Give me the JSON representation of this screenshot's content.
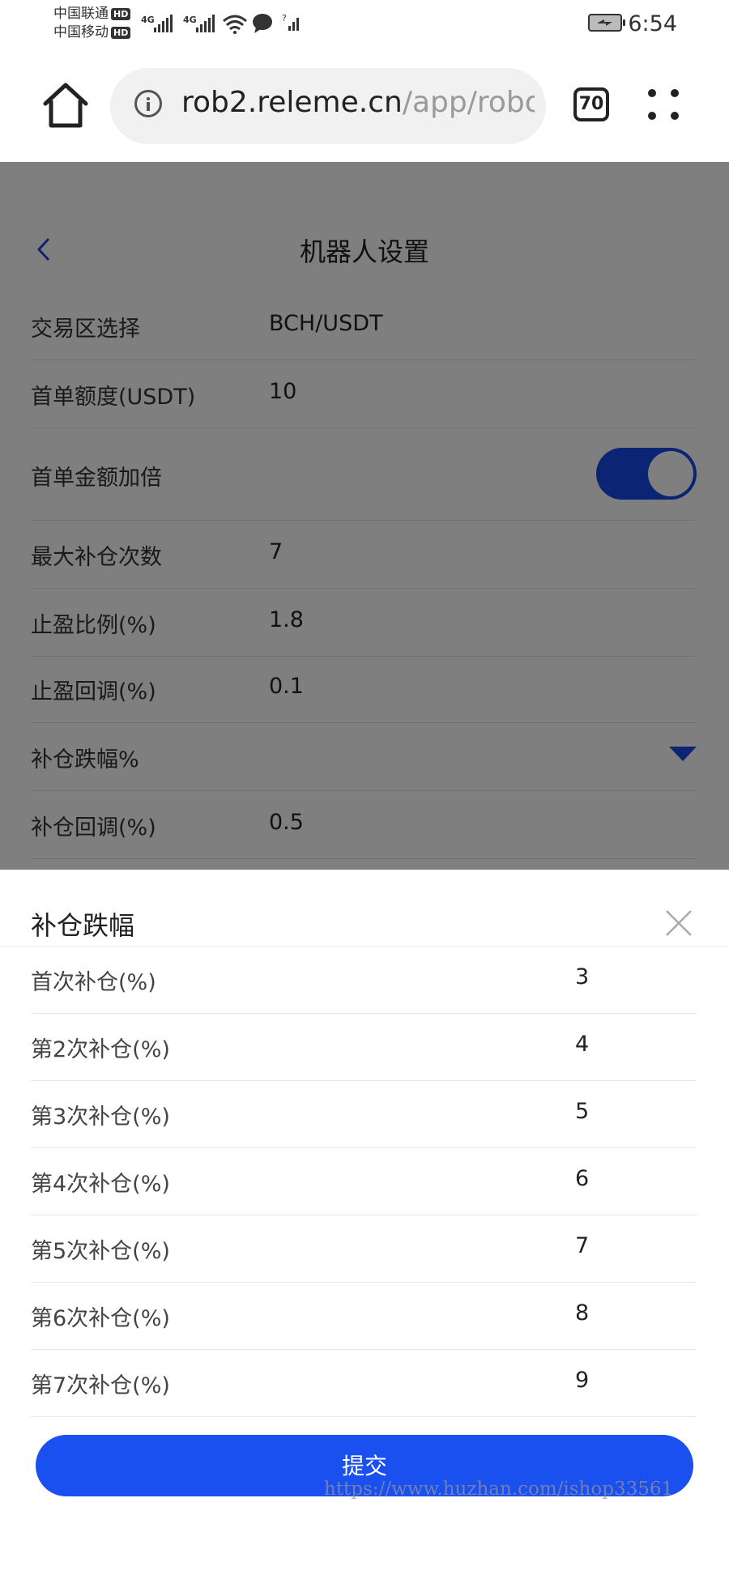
{
  "status_bar": {
    "carrier1": "中国联通",
    "carrier2": "中国移动",
    "hd": "HD",
    "net1": "4G",
    "net2": "4G",
    "time": "6:54"
  },
  "browser": {
    "url_host": "rob2.releme.cn",
    "url_path": "/app/robot",
    "tab_count": "70"
  },
  "page": {
    "title": "机器人设置",
    "rows": [
      {
        "label": "交易区选择",
        "value": "BCH/USDT"
      },
      {
        "label": "首单额度(USDT)",
        "value": "10"
      },
      {
        "label": "首单金额加倍",
        "toggle": true
      },
      {
        "label": "最大补仓次数",
        "value": "7"
      },
      {
        "label": "止盈比例(%)",
        "value": "1.8"
      },
      {
        "label": "止盈回调(%)",
        "value": "0.1"
      },
      {
        "label": "补仓跌幅%",
        "dropdown": true
      },
      {
        "label": "补仓回调(%)",
        "value": "0.5"
      }
    ]
  },
  "sheet": {
    "title": "补仓跌幅",
    "rows": [
      {
        "label": "首次补仓(%)",
        "value": "3"
      },
      {
        "label": "第2次补仓(%)",
        "value": "4"
      },
      {
        "label": "第3次补仓(%)",
        "value": "5"
      },
      {
        "label": "第4次补仓(%)",
        "value": "6"
      },
      {
        "label": "第5次补仓(%)",
        "value": "7"
      },
      {
        "label": "第6次补仓(%)",
        "value": "8"
      },
      {
        "label": "第7次补仓(%)",
        "value": "9"
      }
    ],
    "submit_label": "提交"
  },
  "watermark": "https://www.huzhan.com/ishop33561",
  "colors": {
    "accent": "#1a4ff0",
    "toggle": "#1648e6"
  }
}
